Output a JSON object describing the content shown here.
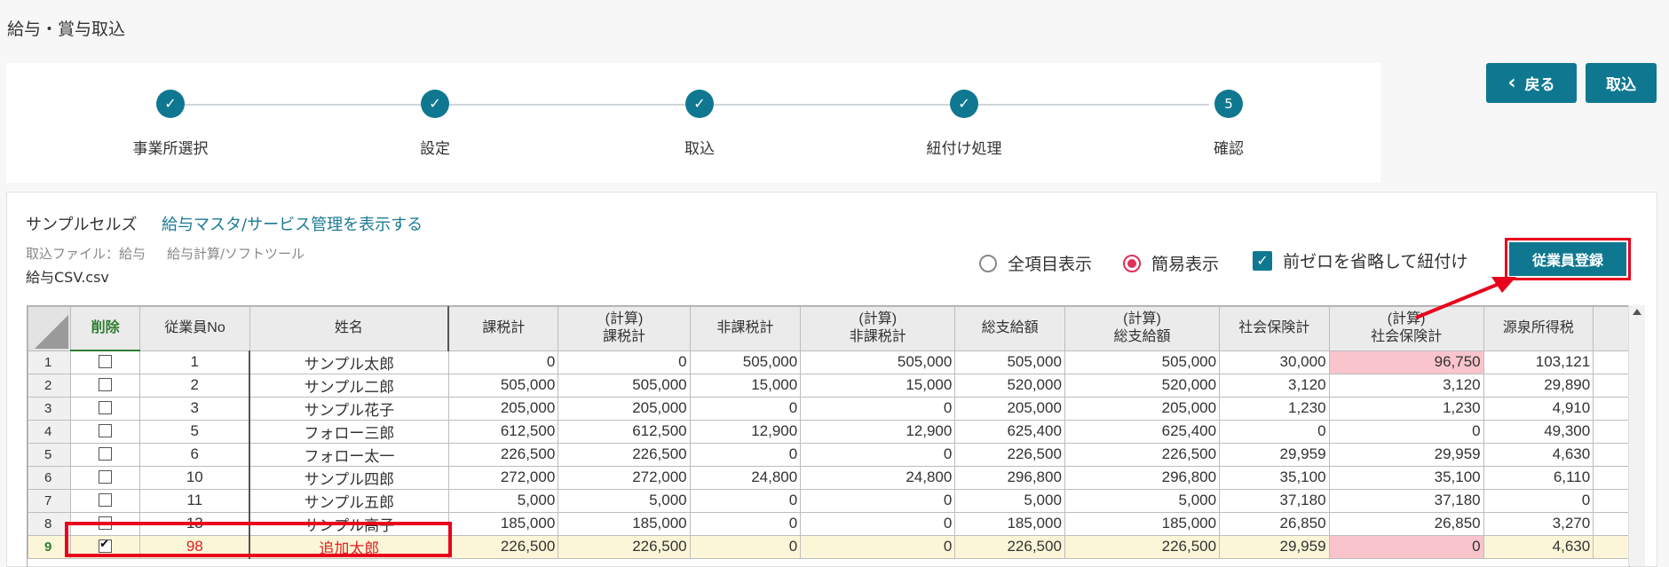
{
  "page_title": "給与・賞与取込",
  "steps": [
    {
      "label": "事業所選択",
      "done": true,
      "mark": "✓"
    },
    {
      "label": "設定",
      "done": true,
      "mark": "✓"
    },
    {
      "label": "取込",
      "done": true,
      "mark": "✓"
    },
    {
      "label": "紐付け処理",
      "done": true,
      "mark": "✓"
    },
    {
      "label": "確認",
      "done": false,
      "mark": "5"
    }
  ],
  "buttons": {
    "back": "戻る",
    "import": "取込",
    "register": "従業員登録"
  },
  "company": "サンプルセルズ",
  "master_link": "給与マスタ/サービス管理を表示する",
  "file": {
    "label": "取込ファイル：給与",
    "type": "給与計算/ソフトツール",
    "name": "給与CSV.csv"
  },
  "options": {
    "all_items": "全項目表示",
    "simple": "簡易表示",
    "zero": "前ゼロを省略して紐付け"
  },
  "table": {
    "headers": [
      "削除",
      "従業員No",
      "姓名",
      "課税計",
      "(計算)\n課税計",
      "非課税計",
      "(計算)\n非課税計",
      "総支給額",
      "(計算)\n総支給額",
      "社会保険計",
      "(計算)\n社会保険計",
      "源泉所得税"
    ],
    "rows": [
      {
        "idx": "1",
        "checked": false,
        "no": "1",
        "name": "サンプル太郎",
        "vals": [
          "0",
          "0",
          "505,000",
          "505,000",
          "505,000",
          "505,000",
          "30,000",
          "96,750",
          "103,121"
        ],
        "pink": [
          7
        ]
      },
      {
        "idx": "2",
        "checked": false,
        "no": "2",
        "name": "サンプル二郎",
        "vals": [
          "505,000",
          "505,000",
          "15,000",
          "15,000",
          "520,000",
          "520,000",
          "3,120",
          "3,120",
          "29,890"
        ],
        "pink": []
      },
      {
        "idx": "3",
        "checked": false,
        "no": "3",
        "name": "サンプル花子",
        "vals": [
          "205,000",
          "205,000",
          "0",
          "0",
          "205,000",
          "205,000",
          "1,230",
          "1,230",
          "4,910"
        ],
        "pink": []
      },
      {
        "idx": "4",
        "checked": false,
        "no": "5",
        "name": "フォロー三郎",
        "vals": [
          "612,500",
          "612,500",
          "12,900",
          "12,900",
          "625,400",
          "625,400",
          "0",
          "0",
          "49,300"
        ],
        "pink": []
      },
      {
        "idx": "5",
        "checked": false,
        "no": "6",
        "name": "フォロー太一",
        "vals": [
          "226,500",
          "226,500",
          "0",
          "0",
          "226,500",
          "226,500",
          "29,959",
          "29,959",
          "4,630"
        ],
        "pink": []
      },
      {
        "idx": "6",
        "checked": false,
        "no": "10",
        "name": "サンプル四郎",
        "vals": [
          "272,000",
          "272,000",
          "24,800",
          "24,800",
          "296,800",
          "296,800",
          "35,100",
          "35,100",
          "6,110"
        ],
        "pink": []
      },
      {
        "idx": "7",
        "checked": false,
        "no": "11",
        "name": "サンプル五郎",
        "vals": [
          "5,000",
          "5,000",
          "0",
          "0",
          "5,000",
          "5,000",
          "37,180",
          "37,180",
          "0"
        ],
        "pink": []
      },
      {
        "idx": "8",
        "checked": false,
        "no": "13",
        "name": "サンプル高子",
        "vals": [
          "185,000",
          "185,000",
          "0",
          "0",
          "185,000",
          "185,000",
          "26,850",
          "26,850",
          "3,270"
        ],
        "pink": []
      },
      {
        "idx": "9",
        "checked": true,
        "no": "98",
        "name": "追加太郎",
        "vals": [
          "226,500",
          "226,500",
          "0",
          "0",
          "226,500",
          "226,500",
          "29,959",
          "0",
          "4,630"
        ],
        "pink": [
          7
        ],
        "highlight": true
      }
    ]
  },
  "colors": {
    "teal": "#0f7890",
    "red_annotation": "#e8001c",
    "pink_cell": "#f9c4cc",
    "highlight_row": "#fcf6d8"
  }
}
